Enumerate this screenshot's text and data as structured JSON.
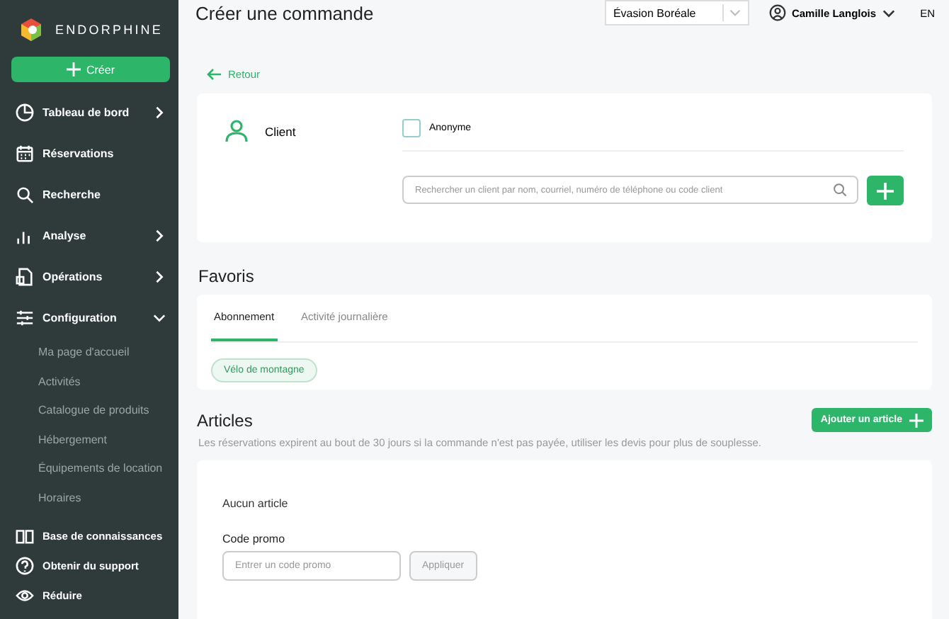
{
  "sidebar": {
    "brand": "ENDORPHINE",
    "create_button": "Créer",
    "items": [
      {
        "label": "Tableau de bord",
        "expanded": false
      },
      {
        "label": "Réservations"
      },
      {
        "label": "Recherche"
      },
      {
        "label": "Analyse",
        "expanded": false
      },
      {
        "label": "Opérations",
        "expanded": false
      },
      {
        "label": "Configuration",
        "expanded": true,
        "children": [
          {
            "label": "Ma page d'accueil"
          },
          {
            "label": "Activités"
          },
          {
            "label": "Catalogue de produits"
          },
          {
            "label": "Hébergement"
          },
          {
            "label": "Équipements de location"
          },
          {
            "label": "Horaires"
          }
        ]
      }
    ],
    "footer_items": [
      {
        "label": "Base de connaissances"
      },
      {
        "label": "Obtenir du support"
      },
      {
        "label": "Réduire"
      }
    ]
  },
  "header": {
    "title": "Créer une commande",
    "organization_select": "Évasion Boréale",
    "user": "Camille Langlois",
    "language": "EN"
  },
  "back_link": "Retour",
  "client": {
    "label": "Client",
    "anonymous": {
      "label": "Anonyme",
      "checked": false
    },
    "search": {
      "placeholder": "Rechercher un client par nom, courriel, numéro de téléphone ou code client"
    }
  },
  "favorites": {
    "title": "Favoris",
    "tabs": [
      {
        "label": "Abonnement",
        "selected": true
      },
      {
        "label": "Activité journalière",
        "selected": false
      }
    ],
    "chips": [
      "Vélo de montagne"
    ]
  },
  "articles": {
    "title": "Articles",
    "add_button": "Ajouter un article",
    "note": "Les réservations expirent au bout de 30 jours si la commande n'est pas payée, utiliser les devis pour plus de souplesse.",
    "empty": "Aucun article",
    "promo": {
      "label": "Code promo",
      "placeholder": "Entrer un code promo",
      "button": "Appliquer"
    }
  }
}
